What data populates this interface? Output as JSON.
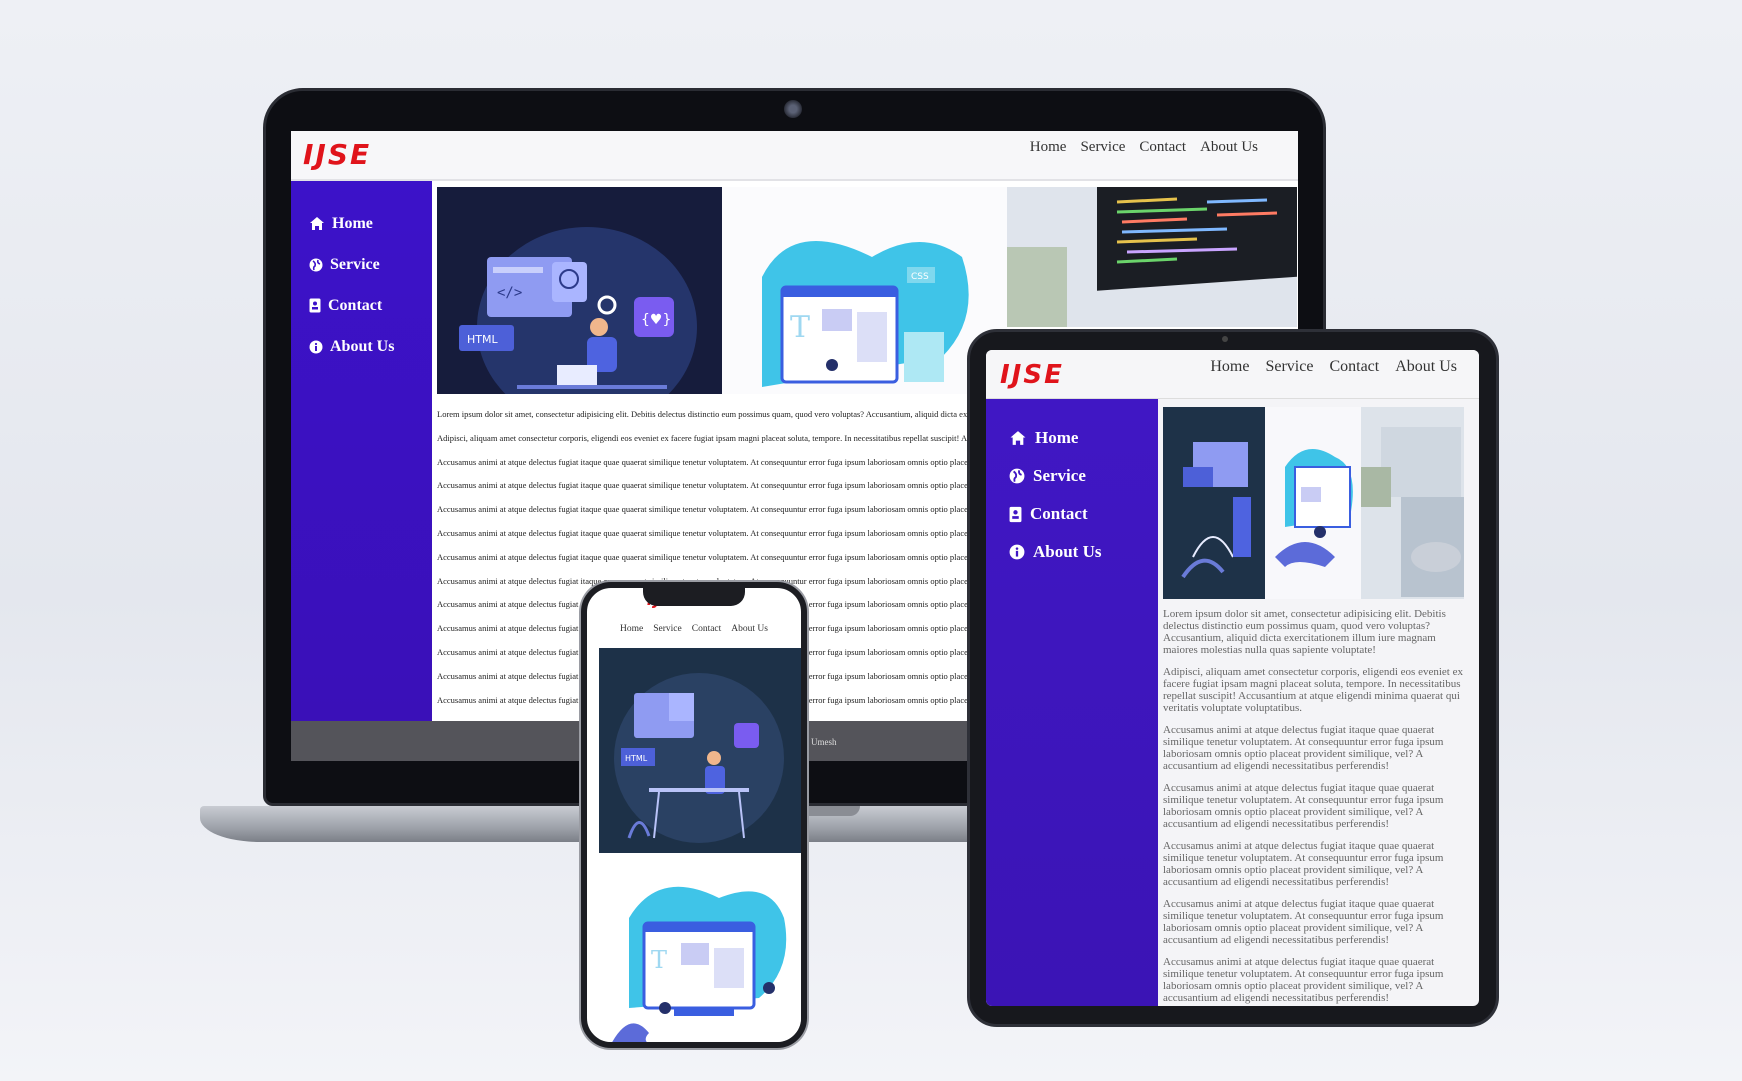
{
  "brand": {
    "logo_text": "IJSE",
    "accent": "#e0141b",
    "sidebar_color": "#3c12c9"
  },
  "nav": {
    "home": "Home",
    "service": "Service",
    "contact": "Contact",
    "about": "About Us"
  },
  "sidebar": {
    "home": "Home",
    "service": "Service",
    "contact": "Contact",
    "about": "About Us"
  },
  "illustrations": {
    "html_badge": "HTML",
    "code_tag": "</>",
    "css_badge": "CSS",
    "letter_t": "T"
  },
  "content": {
    "para1": "Lorem ipsum dolor sit amet, consectetur adipisicing elit. Debitis delectus distinctio eum possimus quam, quod vero voluptas? Accusantium, aliquid dicta exercitationem illum iure magnam maiores molestias nulla quas sapiente voluptate!",
    "para2": "Adipisci, aliquam amet consectetur corporis, eligendi eos eveniet ex facere fugiat ipsam magni placeat soluta, tempore. In necessitatibus repellat suscipit! Accusantium at atque eligendi minima quaerat qui veritatis voluptate voluptatibus.",
    "para3": "Accusamus animi at atque delectus fugiat itaque quae quaerat similique tenetur voluptatem. At consequuntur error fuga ipsum laboriosam omnis optio placeat provident similique, vel? A accusantium ad eligendi necessitatibus perferendis!"
  },
  "footer": {
    "text": "Umesh"
  }
}
